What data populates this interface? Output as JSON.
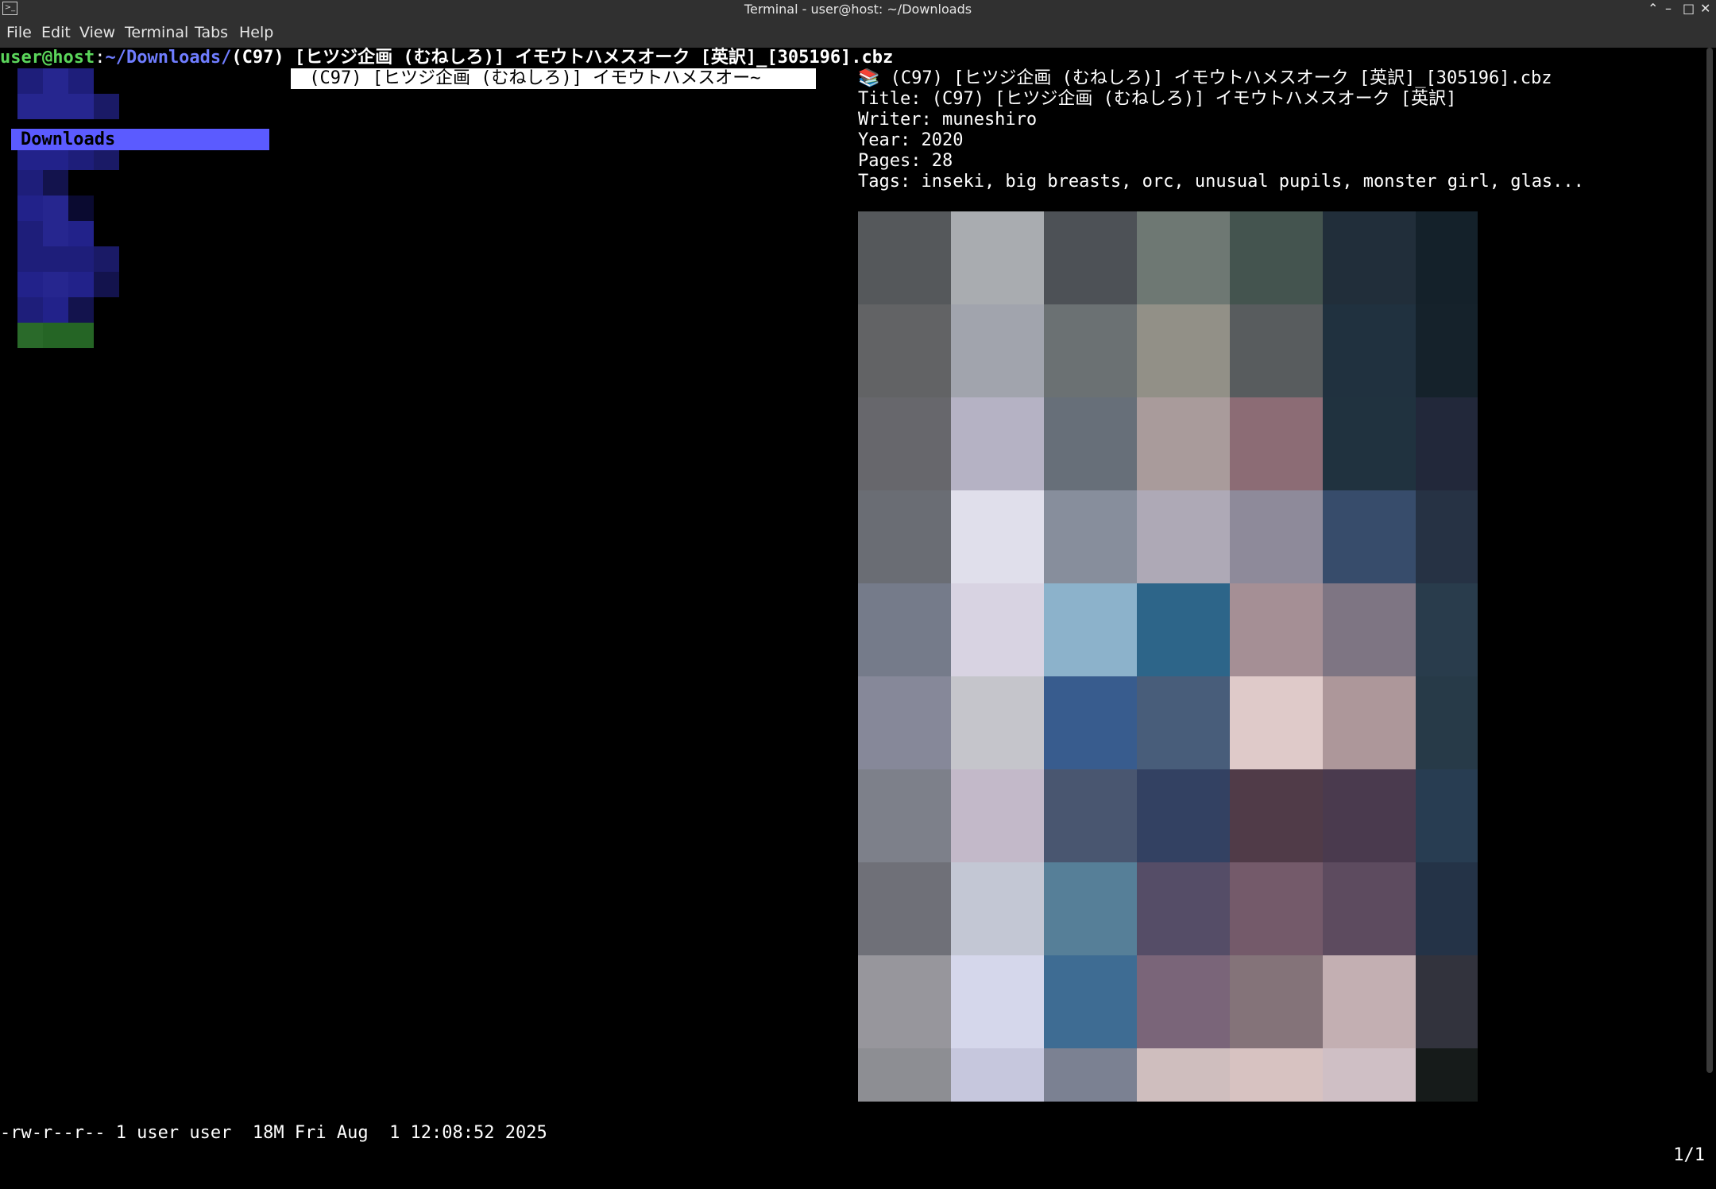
{
  "window": {
    "title": "Terminal - user@host: ~/Downloads",
    "minimize": "⌃",
    "restore": "–",
    "maximize": "□",
    "close": "✕"
  },
  "menu": [
    "File",
    "Edit",
    "View",
    "Terminal",
    "Tabs",
    "Help"
  ],
  "prompt": {
    "user_host": "user@host",
    "colon": ":",
    "path": "~/Downloads/",
    "current_file": "(C97) [ヒツジ企画 (むねしろ)] イモウトハメスオーク [英訳]_[305196].cbz"
  },
  "sidebar": {
    "selected_dir": "Downloads"
  },
  "file_list": {
    "highlighted": " (C97) [ヒツジ企画 (むねしろ)] イモウトハメスオー~"
  },
  "preview": {
    "header": "📚 (C97) [ヒツジ企画 (むねしろ)] イモウトハメスオーク [英訳]_[305196].cbz",
    "title": "Title: (C97) [ヒツジ企画 (むねしろ)] イモウトハメスオーク [英訳]",
    "writer": "Writer: muneshiro",
    "year": "Year: 2020",
    "pages": "Pages: 28",
    "tags": "Tags: inseki, big breasts, orc, unusual pupils, monster girl, glas..."
  },
  "status": {
    "left": "-rw-r--r-- 1 user user  18M Fri Aug  1 12:08:52 2025",
    "right": "1/1"
  },
  "colors": {
    "prompt_green": "#5bd65b",
    "path_blue": "#6f7dff",
    "selection": "#5b5bff",
    "cover_cells": [
      "#55585b",
      "#a9acb0",
      "#4d5156",
      "#6e7873",
      "#44544f",
      "#212e3a",
      "#14212a",
      "#626365",
      "#a1a4ad",
      "#6b7173",
      "#929087",
      "#585c5e",
      "#20313f",
      "#15222b",
      "#67676c",
      "#b5b2c4",
      "#676f79",
      "#a99b9b",
      "#8c6c75",
      "#20323f",
      "#22283a",
      "#6a6d74",
      "#e0dfeb",
      "#878e9c",
      "#aea9b6",
      "#8e8a9a",
      "#374c6b",
      "#263244",
      "#757b8a",
      "#d8d3e2",
      "#8cb2cb",
      "#2d6589",
      "#a58f95",
      "#7e7583",
      "#293c4c",
      "#868899",
      "#c5c5cb",
      "#385c8e",
      "#485d7a",
      "#dfcac9",
      "#ad979a",
      "#273a48",
      "#7d808a",
      "#c3b9c9",
      "#495670",
      "#334162",
      "#503b48",
      "#4a3a4e",
      "#283d52",
      "#6f7078",
      "#c3c7d4",
      "#567f98",
      "#554d67",
      "#745a6a",
      "#5d4b5f",
      "#243347",
      "#97969c",
      "#d5d7eb",
      "#3e6c93",
      "#7a6579",
      "#847379",
      "#c3afb2",
      "#32333d",
      "#8d8e93",
      "#c6c7dd",
      "#7b8192",
      "#cfbebe",
      "#d7c2c1",
      "#cfbfc5",
      "#161b1a"
    ],
    "thumb_cells": [
      "#1e1e7a",
      "#26268f",
      "#1e1e7a",
      "#000000",
      "#26268f",
      "#26268f",
      "#26268f",
      "#1a1a66",
      "#000000",
      "#000000",
      "#000000",
      "#000000",
      "#22228a",
      "#22228a",
      "#1e1e7a",
      "#1a1a66",
      "#1e1e7a",
      "#13134d",
      "#000000",
      "#000000",
      "#22228a",
      "#26268f",
      "#0a0a30",
      "#000000",
      "#1e1e7a",
      "#26268f",
      "#22228a",
      "#000000",
      "#1e1e7a",
      "#1e1e7a",
      "#1e1e7a",
      "#1a1a66",
      "#22228a",
      "#26268f",
      "#22228a",
      "#13134d",
      "#1e1e7a",
      "#22228a",
      "#13134d",
      "#000000",
      "#2a6a2a",
      "#256525",
      "#256525",
      "#000000"
    ]
  }
}
